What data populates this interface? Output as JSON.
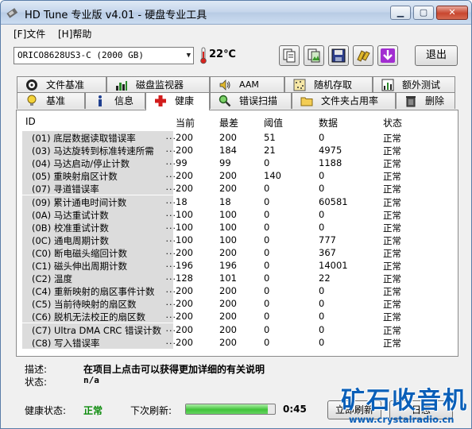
{
  "window": {
    "title": "HD Tune 专业版 v4.01 - 硬盘专业工具"
  },
  "menu": {
    "file": "[F]文件",
    "help": "[H]帮助"
  },
  "toolbar": {
    "drive": "ORICO8628US3-C (2000 GB)",
    "temperature": "22℃",
    "exit_label": "退出",
    "buttons": [
      "copy-text-icon",
      "copy-screenshot-icon",
      "save-icon",
      "options-icon",
      "download-icon"
    ]
  },
  "tabs_row1": [
    {
      "label": "文件基准",
      "icon": "file-benchmark-icon"
    },
    {
      "label": "磁盘监视器",
      "icon": "disk-monitor-icon"
    },
    {
      "label": "AAM",
      "icon": "speaker-icon"
    },
    {
      "label": "随机存取",
      "icon": "random-access-icon"
    },
    {
      "label": "额外测试",
      "icon": "extra-tests-icon"
    }
  ],
  "tabs_row2": [
    {
      "label": "基准",
      "icon": "lightbulb-icon"
    },
    {
      "label": "信息",
      "icon": "info-icon"
    },
    {
      "label": "健康",
      "icon": "health-cross-icon",
      "active": true
    },
    {
      "label": "错误扫描",
      "icon": "magnifier-icon"
    },
    {
      "label": "文件夹占用率",
      "icon": "folder-icon"
    },
    {
      "label": "删除",
      "icon": "trash-icon"
    }
  ],
  "table": {
    "headers": {
      "id": "ID",
      "current": "当前",
      "worst": "最差",
      "threshold": "阈值",
      "data": "数据",
      "status": "状态"
    },
    "rows": [
      {
        "id": "(01) 底层数据读取错误率",
        "current": "200",
        "worst": "200",
        "threshold": "51",
        "data": "0",
        "status": "正常"
      },
      {
        "id": "(03) 马达旋转到标准转速所需",
        "current": "200",
        "worst": "184",
        "threshold": "21",
        "data": "4975",
        "status": "正常"
      },
      {
        "id": "(04) 马达启动/停止计数",
        "current": "99",
        "worst": "99",
        "threshold": "0",
        "data": "1188",
        "status": "正常"
      },
      {
        "id": "(05) 重映射扇区计数",
        "current": "200",
        "worst": "200",
        "threshold": "140",
        "data": "0",
        "status": "正常"
      },
      {
        "id": "(07) 寻道错误率",
        "current": "200",
        "worst": "200",
        "threshold": "0",
        "data": "0",
        "status": "正常"
      },
      {
        "id": "(09) 累计通电时间计数",
        "current": "18",
        "worst": "18",
        "threshold": "0",
        "data": "60581",
        "status": "正常"
      },
      {
        "id": "(0A) 马达重试计数",
        "current": "100",
        "worst": "100",
        "threshold": "0",
        "data": "0",
        "status": "正常"
      },
      {
        "id": "(0B) 校准重试计数",
        "current": "100",
        "worst": "100",
        "threshold": "0",
        "data": "0",
        "status": "正常"
      },
      {
        "id": "(0C) 通电周期计数",
        "current": "100",
        "worst": "100",
        "threshold": "0",
        "data": "777",
        "status": "正常"
      },
      {
        "id": "(C0) 断电磁头缩回计数",
        "current": "200",
        "worst": "200",
        "threshold": "0",
        "data": "367",
        "status": "正常"
      },
      {
        "id": "(C1) 磁头伸出周期计数",
        "current": "196",
        "worst": "196",
        "threshold": "0",
        "data": "14001",
        "status": "正常"
      },
      {
        "id": "(C2) 温度",
        "current": "128",
        "worst": "101",
        "threshold": "0",
        "data": "22",
        "status": "正常"
      },
      {
        "id": "(C4) 重新映射的扇区事件计数",
        "current": "200",
        "worst": "200",
        "threshold": "0",
        "data": "0",
        "status": "正常"
      },
      {
        "id": "(C5) 当前待映射的扇区数",
        "current": "200",
        "worst": "200",
        "threshold": "0",
        "data": "0",
        "status": "正常"
      },
      {
        "id": "(C6) 脱机无法校正的扇区数",
        "current": "200",
        "worst": "200",
        "threshold": "0",
        "data": "0",
        "status": "正常"
      },
      {
        "id": "(C7) Ultra DMA CRC 错误计数",
        "current": "200",
        "worst": "200",
        "threshold": "0",
        "data": "0",
        "status": "正常"
      },
      {
        "id": "(C8) 写入错误率",
        "current": "200",
        "worst": "200",
        "threshold": "0",
        "data": "0",
        "status": "正常"
      }
    ]
  },
  "details": {
    "desc_label": "描述:",
    "desc_text": "在项目上点击可以获得更加详细的有关说明",
    "status_label": "状态:",
    "status_text": "n/a"
  },
  "footer": {
    "health_label": "健康状态:",
    "health_value": "正常",
    "next_refresh_label": "下次刷新:",
    "progress_fraction": 0.92,
    "countdown": "0:45",
    "refresh_button": "立即刷新",
    "log_button": "日志"
  },
  "watermark": {
    "brand": "矿石收音机",
    "url": "www.crystalradio.cn"
  },
  "colors": {
    "health_ok": "#0a8a0a",
    "watermark": "#0a5fb8",
    "active_tab_icon": "#d21c1c"
  }
}
